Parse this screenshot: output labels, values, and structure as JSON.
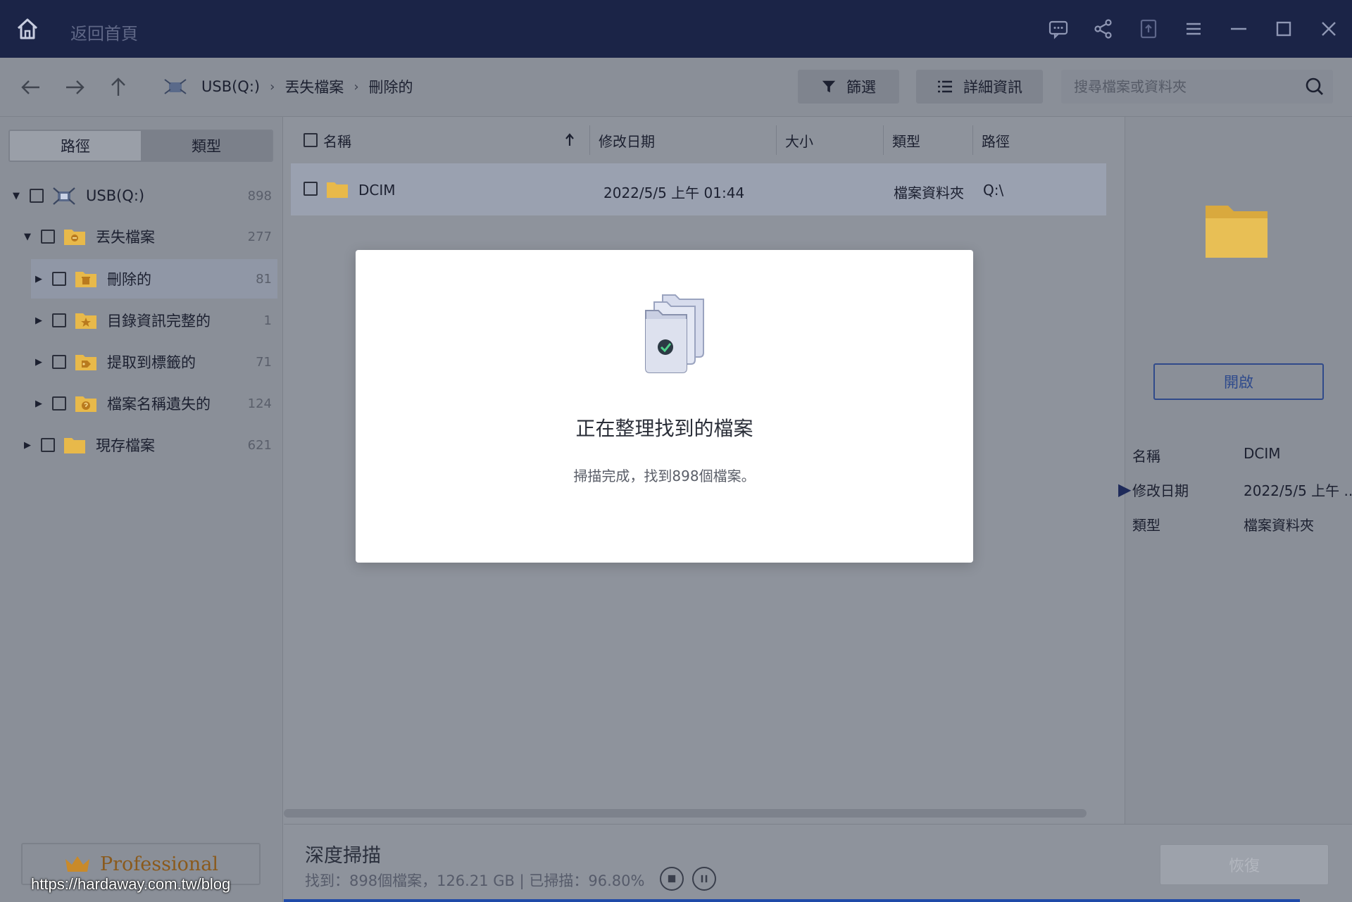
{
  "titlebar": {
    "home_label": "返回首頁"
  },
  "toolbar": {
    "breadcrumb": [
      "USB(Q:)",
      "丟失檔案",
      "刪除的"
    ],
    "filter_label": "篩選",
    "details_label": "詳細資訊",
    "search_placeholder": "搜尋檔案或資料夾"
  },
  "left_panel": {
    "tabs": [
      "路徑",
      "類型"
    ],
    "tree": [
      {
        "label": "USB(Q:)",
        "count": "898"
      },
      {
        "label": "丟失檔案",
        "count": "277"
      },
      {
        "label": "刪除的",
        "count": "81"
      },
      {
        "label": "目錄資訊完整的",
        "count": "1"
      },
      {
        "label": "提取到標籤的",
        "count": "71"
      },
      {
        "label": "檔案名稱遺失的",
        "count": "124"
      },
      {
        "label": "現存檔案",
        "count": "621"
      }
    ],
    "professional_label": "Professional",
    "watermark": "https://hardaway.com.tw/blog"
  },
  "file_list": {
    "columns": [
      "名稱",
      "修改日期",
      "大小",
      "類型",
      "路徑"
    ],
    "rows": [
      {
        "name": "DCIM",
        "date": "2022/5/5 上午 01:44",
        "size": "",
        "type": "檔案資料夾",
        "path": "Q:\\"
      }
    ]
  },
  "details": {
    "open_label": "開啟",
    "props": [
      {
        "key": "名稱",
        "value": "DCIM"
      },
      {
        "key": "修改日期",
        "value": "2022/5/5 上午 .."
      },
      {
        "key": "類型",
        "value": "檔案資料夾"
      }
    ]
  },
  "status": {
    "title": "深度掃描",
    "text": "找到：898個檔案，126.21 GB | 已掃描：96.80%",
    "progress_fraction": 0.968,
    "recover_label": "恢復"
  },
  "modal": {
    "title": "正在整理找到的檔案",
    "subtitle": "掃描完成，找到898個檔案。"
  },
  "colors": {
    "titlebar": "#1b2447",
    "folder": "#e8b94a",
    "accent": "#1f4aa8"
  }
}
